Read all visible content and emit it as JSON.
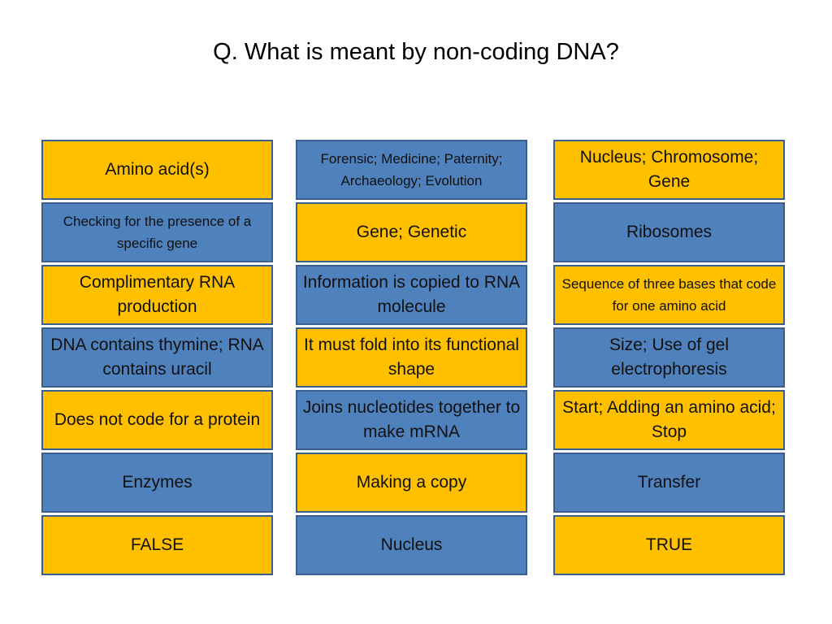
{
  "title": "Q. What is meant by non-coding DNA?",
  "colors": {
    "yellow": "#FFC000",
    "blue": "#4F81BD",
    "border": "#3A5F8E"
  },
  "columns": [
    {
      "cells": [
        {
          "text": "Amino acid(s)",
          "color": "yellow"
        },
        {
          "text": "Checking for the presence of a specific gene",
          "color": "blue",
          "small": true
        },
        {
          "text": "Complimentary RNA production",
          "color": "yellow"
        },
        {
          "text": "DNA contains thymine; RNA contains uracil",
          "color": "blue"
        },
        {
          "text": "Does not code for a protein",
          "color": "yellow"
        },
        {
          "text": "Enzymes",
          "color": "blue"
        },
        {
          "text": "FALSE",
          "color": "yellow"
        }
      ]
    },
    {
      "cells": [
        {
          "text": "Forensic; Medicine; Paternity; Archaeology; Evolution",
          "color": "blue",
          "small": true
        },
        {
          "text": "Gene; Genetic",
          "color": "yellow"
        },
        {
          "text": "Information is copied to RNA molecule",
          "color": "blue"
        },
        {
          "text": "It must fold into its functional shape",
          "color": "yellow"
        },
        {
          "text": "Joins nucleotides together to make mRNA",
          "color": "blue"
        },
        {
          "text": "Making a copy",
          "color": "yellow"
        },
        {
          "text": "Nucleus",
          "color": "blue"
        }
      ]
    },
    {
      "cells": [
        {
          "text": "Nucleus; Chromosome; Gene",
          "color": "yellow"
        },
        {
          "text": "Ribosomes",
          "color": "blue"
        },
        {
          "text": "Sequence of three bases that code for one amino acid",
          "color": "yellow",
          "small": true
        },
        {
          "text": "Size; Use of gel electrophoresis",
          "color": "blue"
        },
        {
          "text": "Start; Adding an amino acid; Stop",
          "color": "yellow"
        },
        {
          "text": "Transfer",
          "color": "blue"
        },
        {
          "text": "TRUE",
          "color": "yellow"
        }
      ]
    }
  ]
}
